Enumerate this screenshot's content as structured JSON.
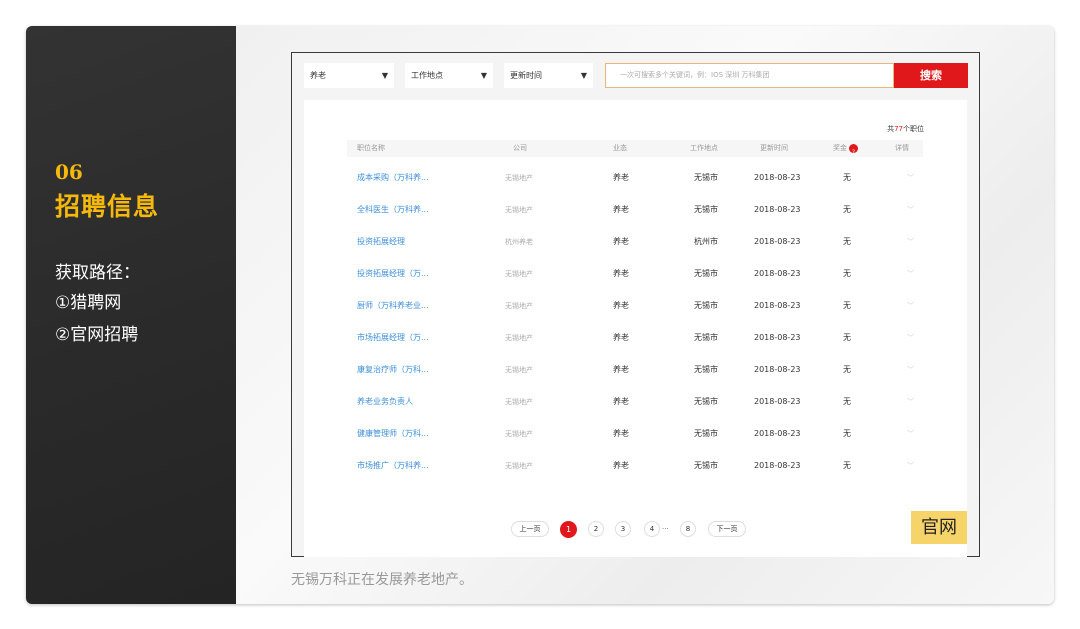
{
  "sidebar": {
    "number": "06",
    "title": "招聘信息",
    "path_label": "获取路径：",
    "path_items": [
      "①猎聘网",
      "②官网招聘"
    ]
  },
  "caption": "无锡万科正在发展养老地产。",
  "badge_label": "官网",
  "search_bar": {
    "filters": [
      {
        "label": "养老",
        "arrow": "▼"
      },
      {
        "label": "工作地点",
        "arrow": "▼"
      },
      {
        "label": "更新时间",
        "arrow": "▼"
      }
    ],
    "placeholder": "一次可搜索多个关键词，例：IOS 深圳 万科集团",
    "button_label": "搜索"
  },
  "results": {
    "total_prefix": "共",
    "total_number": "77",
    "total_suffix": "个职位",
    "columns": {
      "title": "职位名称",
      "company": "公司",
      "business": "业态",
      "location": "工作地点",
      "updated": "更新时间",
      "fund": "奖金",
      "fund_badge": "?",
      "detail": "详情"
    },
    "rows": [
      {
        "title": "成本采购（万科养...",
        "company": "无锡地产",
        "business": "养老",
        "city": "无锡市",
        "date": "2018-08-23",
        "fund": "无",
        "detail": "﹀"
      },
      {
        "title": "全科医生（万科养...",
        "company": "无锡地产",
        "business": "养老",
        "city": "无锡市",
        "date": "2018-08-23",
        "fund": "无",
        "detail": "﹀"
      },
      {
        "title": "投资拓展经理",
        "company": "杭州养老",
        "business": "养老",
        "city": "杭州市",
        "date": "2018-08-23",
        "fund": "无",
        "detail": "﹀"
      },
      {
        "title": "投资拓展经理（万...",
        "company": "无锡地产",
        "business": "养老",
        "city": "无锡市",
        "date": "2018-08-23",
        "fund": "无",
        "detail": "﹀"
      },
      {
        "title": "厨师（万科养老业...",
        "company": "无锡地产",
        "business": "养老",
        "city": "无锡市",
        "date": "2018-08-23",
        "fund": "无",
        "detail": "﹀"
      },
      {
        "title": "市场拓展经理（万...",
        "company": "无锡地产",
        "business": "养老",
        "city": "无锡市",
        "date": "2018-08-23",
        "fund": "无",
        "detail": "﹀"
      },
      {
        "title": "康复治疗师（万科...",
        "company": "无锡地产",
        "business": "养老",
        "city": "无锡市",
        "date": "2018-08-23",
        "fund": "无",
        "detail": "﹀"
      },
      {
        "title": "养老业务负责人",
        "company": "无锡地产",
        "business": "养老",
        "city": "无锡市",
        "date": "2018-08-23",
        "fund": "无",
        "detail": "﹀"
      },
      {
        "title": "健康管理师（万科...",
        "company": "无锡地产",
        "business": "养老",
        "city": "无锡市",
        "date": "2018-08-23",
        "fund": "无",
        "detail": "﹀"
      },
      {
        "title": "市场推广（万科养...",
        "company": "无锡地产",
        "business": "养老",
        "city": "无锡市",
        "date": "2018-08-23",
        "fund": "无",
        "detail": "﹀"
      }
    ]
  },
  "pagination": {
    "prev": "上一页",
    "pages": [
      "1",
      "2",
      "3",
      "4"
    ],
    "ellipsis": "···",
    "last": "8",
    "next": "下一页"
  },
  "colors": {
    "accent_red": "#e0181c",
    "title_yellow": "#f5b80d",
    "link_blue": "#3c8fdc",
    "badge_yellow": "#f7d46a"
  }
}
